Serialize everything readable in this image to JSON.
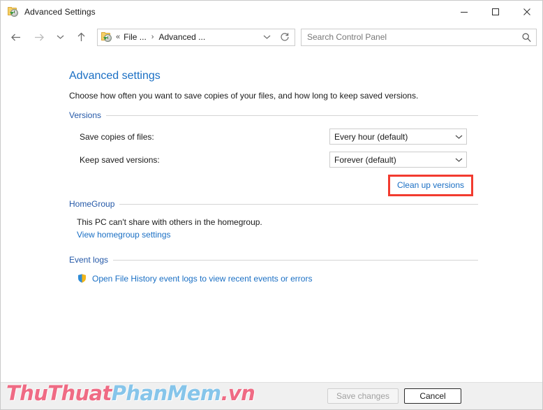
{
  "window": {
    "title": "Advanced Settings",
    "icon": "file-history-icon",
    "controls": {
      "minimize": "minimize-icon",
      "maximize": "maximize-icon",
      "close": "close-icon"
    }
  },
  "navbar": {
    "back": "back-arrow-icon",
    "forward": "forward-arrow-icon",
    "recent": "chevron-down-icon",
    "up": "up-arrow-icon",
    "breadcrumb": {
      "overflow": "«",
      "items": [
        {
          "label": "File ..."
        },
        {
          "label": "Advanced ..."
        }
      ],
      "separator": "›",
      "dropdown": "chevron-down-icon"
    },
    "refresh": "refresh-icon",
    "search": {
      "placeholder": "Search Control Panel",
      "value": "",
      "icon": "search-icon"
    }
  },
  "page": {
    "title": "Advanced settings",
    "subtitle": "Choose how often you want to save copies of your files, and how long to keep saved versions.",
    "sections": {
      "versions": {
        "label": "Versions",
        "rows": [
          {
            "label": "Save copies of files:",
            "value": "Every hour (default)"
          },
          {
            "label": "Keep saved versions:",
            "value": "Forever (default)"
          }
        ],
        "cleanup_link": "Clean up versions",
        "highlight_color": "#f23b2f"
      },
      "homegroup": {
        "label": "HomeGroup",
        "text": "This PC can't share with others in the homegroup.",
        "link": "View homegroup settings"
      },
      "event_logs": {
        "label": "Event logs",
        "icon": "uac-shield-icon",
        "link": "Open File History event logs to view recent events or errors"
      }
    }
  },
  "footer": {
    "save_label": "Save changes",
    "save_enabled": false,
    "cancel_label": "Cancel",
    "cancel_enabled": true
  },
  "watermark": {
    "part1": "ThuThuat",
    "part2": "PhanMem",
    "part3": ".vn",
    "color1": "#ef6b84",
    "color2": "#86c5ea"
  }
}
